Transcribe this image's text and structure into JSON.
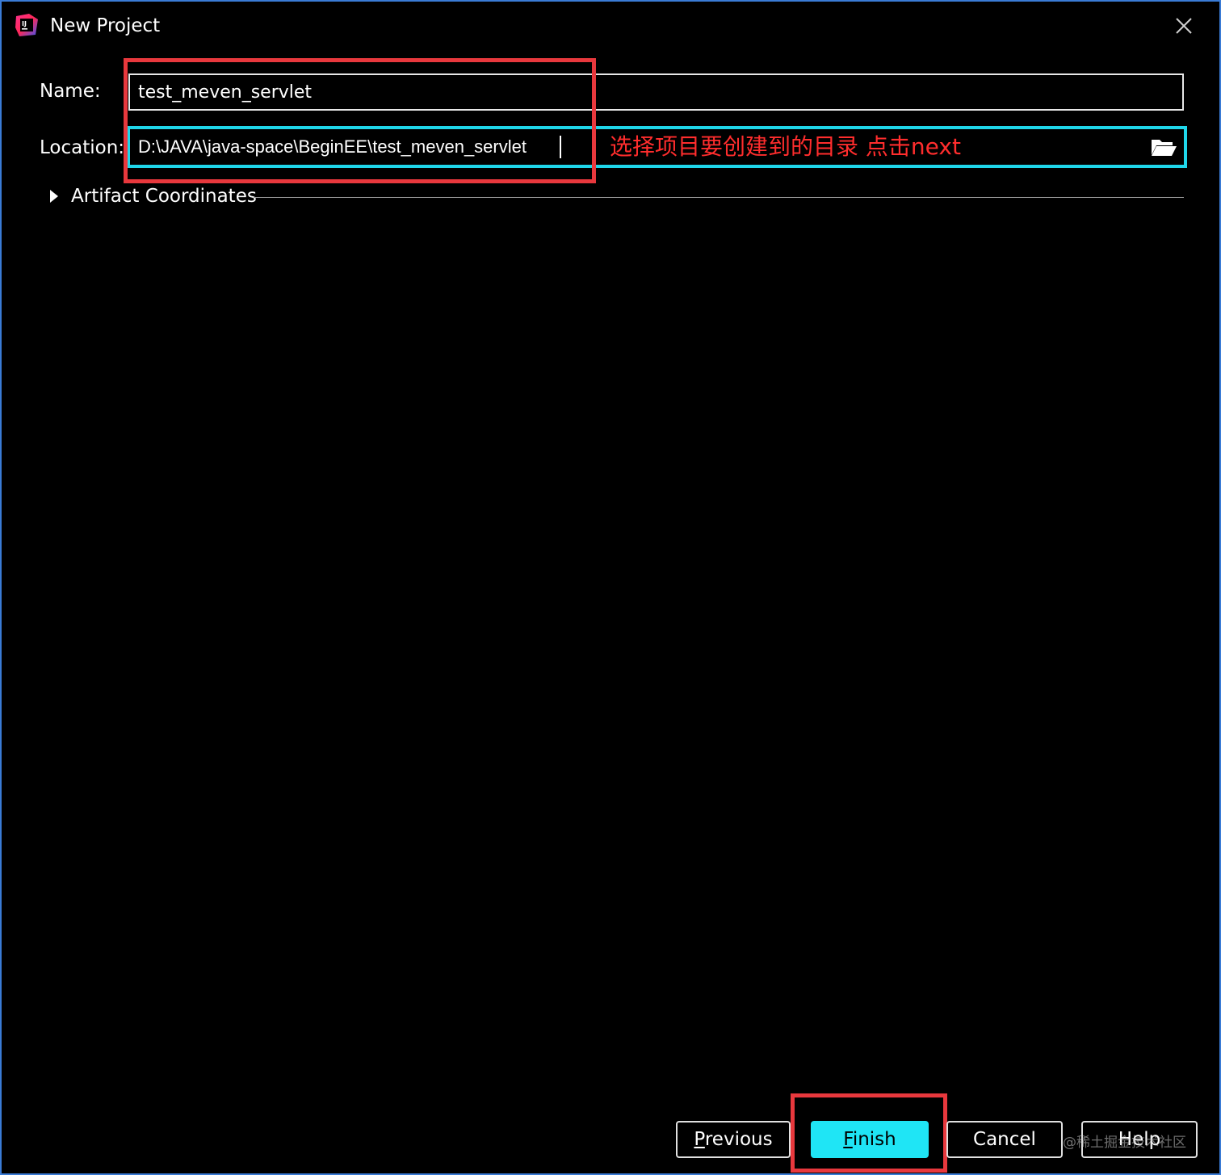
{
  "window": {
    "title": "New Project",
    "border_color": "#3a7bd5"
  },
  "form": {
    "name_label": "Name:",
    "name_value": "test_meven_servlet",
    "location_label": "Location:",
    "location_value": "D:\\JAVA\\java-space\\BeginEE\\test_meven_servlet",
    "artifact_label": "Artifact Coordinates"
  },
  "annotation": {
    "text": "选择项目要创建到的目录 点击next",
    "color": "#ff2d2d",
    "highlight_color": "#e8383d",
    "focus_color": "#1fd6ea"
  },
  "buttons": {
    "previous_mnemonic": "P",
    "previous_rest": "revious",
    "finish_mnemonic": "F",
    "finish_rest": "inish",
    "cancel": "Cancel",
    "help": "Help",
    "finish_color": "#1fe5f5"
  },
  "watermark": "@稀土掘金技术社区",
  "icons": {
    "app": "intellij-idea-icon",
    "close": "close-icon",
    "folder": "folder-open-icon",
    "expand": "triangle-right-icon"
  }
}
